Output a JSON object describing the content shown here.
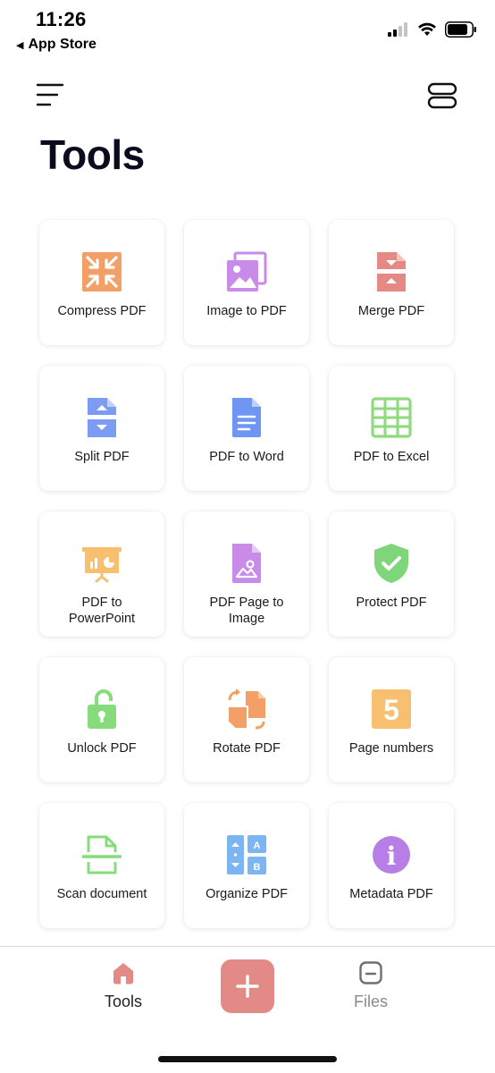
{
  "status_bar": {
    "time": "11:26",
    "back_label": "App Store"
  },
  "header": {
    "title": "Tools"
  },
  "tools": [
    {
      "label": "Compress PDF",
      "icon": "compress-icon",
      "color": "#F2A068"
    },
    {
      "label": "Image to PDF",
      "icon": "image-icon",
      "color": "#C98BE8"
    },
    {
      "label": "Merge PDF",
      "icon": "merge-icon",
      "color": "#E58985"
    },
    {
      "label": "Split PDF",
      "icon": "split-icon",
      "color": "#7C9CF4"
    },
    {
      "label": "PDF to Word",
      "icon": "word-icon",
      "color": "#6F96F2"
    },
    {
      "label": "PDF to Excel",
      "icon": "excel-icon",
      "color": "#8EDB7E"
    },
    {
      "label": "PDF to\nPowerPoint",
      "icon": "presentation-icon",
      "color": "#F7C070"
    },
    {
      "label": "PDF Page to\nImage",
      "icon": "page-image-icon",
      "color": "#C98BE8"
    },
    {
      "label": "Protect PDF",
      "icon": "shield-check-icon",
      "color": "#7FD67A"
    },
    {
      "label": "Unlock PDF",
      "icon": "unlock-icon",
      "color": "#86DB7A"
    },
    {
      "label": "Rotate PDF",
      "icon": "rotate-icon",
      "color": "#F2A068"
    },
    {
      "label": "Page numbers",
      "icon": "page-number-icon",
      "color": "#F7C070",
      "number": "5"
    },
    {
      "label": "Scan document",
      "icon": "scan-icon",
      "color": "#86DB7A"
    },
    {
      "label": "Organize PDF",
      "icon": "organize-icon",
      "color": "#7CB6F2",
      "letters": [
        "A",
        "B"
      ]
    },
    {
      "label": "Metadata PDF",
      "icon": "info-icon",
      "color": "#B77FE6",
      "symbol": "i"
    }
  ],
  "tab_bar": {
    "tools_label": "Tools",
    "files_label": "Files",
    "add_symbol": "+",
    "accent": "#E38A86"
  }
}
